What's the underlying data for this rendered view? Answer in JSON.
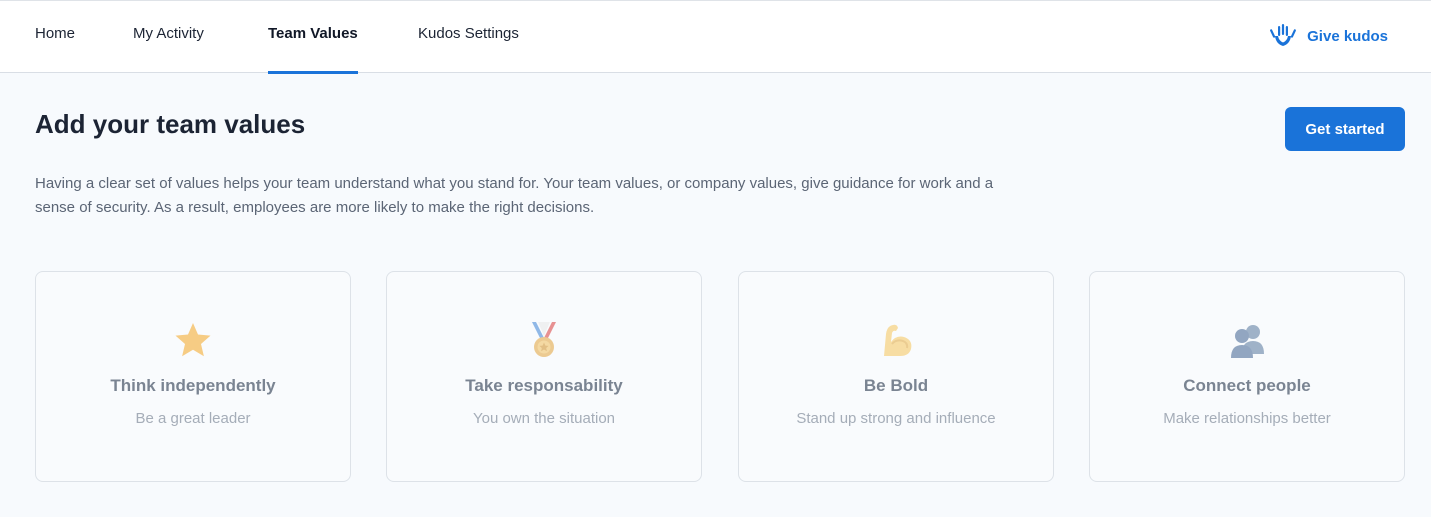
{
  "nav": {
    "tabs": [
      {
        "label": "Home",
        "active": false
      },
      {
        "label": "My Activity",
        "active": false
      },
      {
        "label": "Team Values",
        "active": true
      },
      {
        "label": "Kudos Settings",
        "active": false
      }
    ],
    "give_kudos": {
      "label": "Give kudos",
      "icon": "raised-hands-icon"
    }
  },
  "colors": {
    "accent": "#1a73d9",
    "background": "#f7fafd",
    "title": "#1c2434"
  },
  "main": {
    "title": "Add your team values",
    "cta_label": "Get started",
    "description": "Having a clear set of values helps your team understand what you stand for. Your team values, or company values, give guidance for work and a sense of security. As a result, employees are more likely to make the right decisions."
  },
  "values": [
    {
      "icon": "star-icon",
      "title": "Think independently",
      "subtitle": "Be a great leader"
    },
    {
      "icon": "medal-icon",
      "title": "Take responsability",
      "subtitle": "You own the situation"
    },
    {
      "icon": "flexed-biceps-icon",
      "title": "Be Bold",
      "subtitle": "Stand up strong and influence"
    },
    {
      "icon": "people-silhouettes-icon",
      "title": "Connect people",
      "subtitle": "Make relationships better"
    }
  ]
}
